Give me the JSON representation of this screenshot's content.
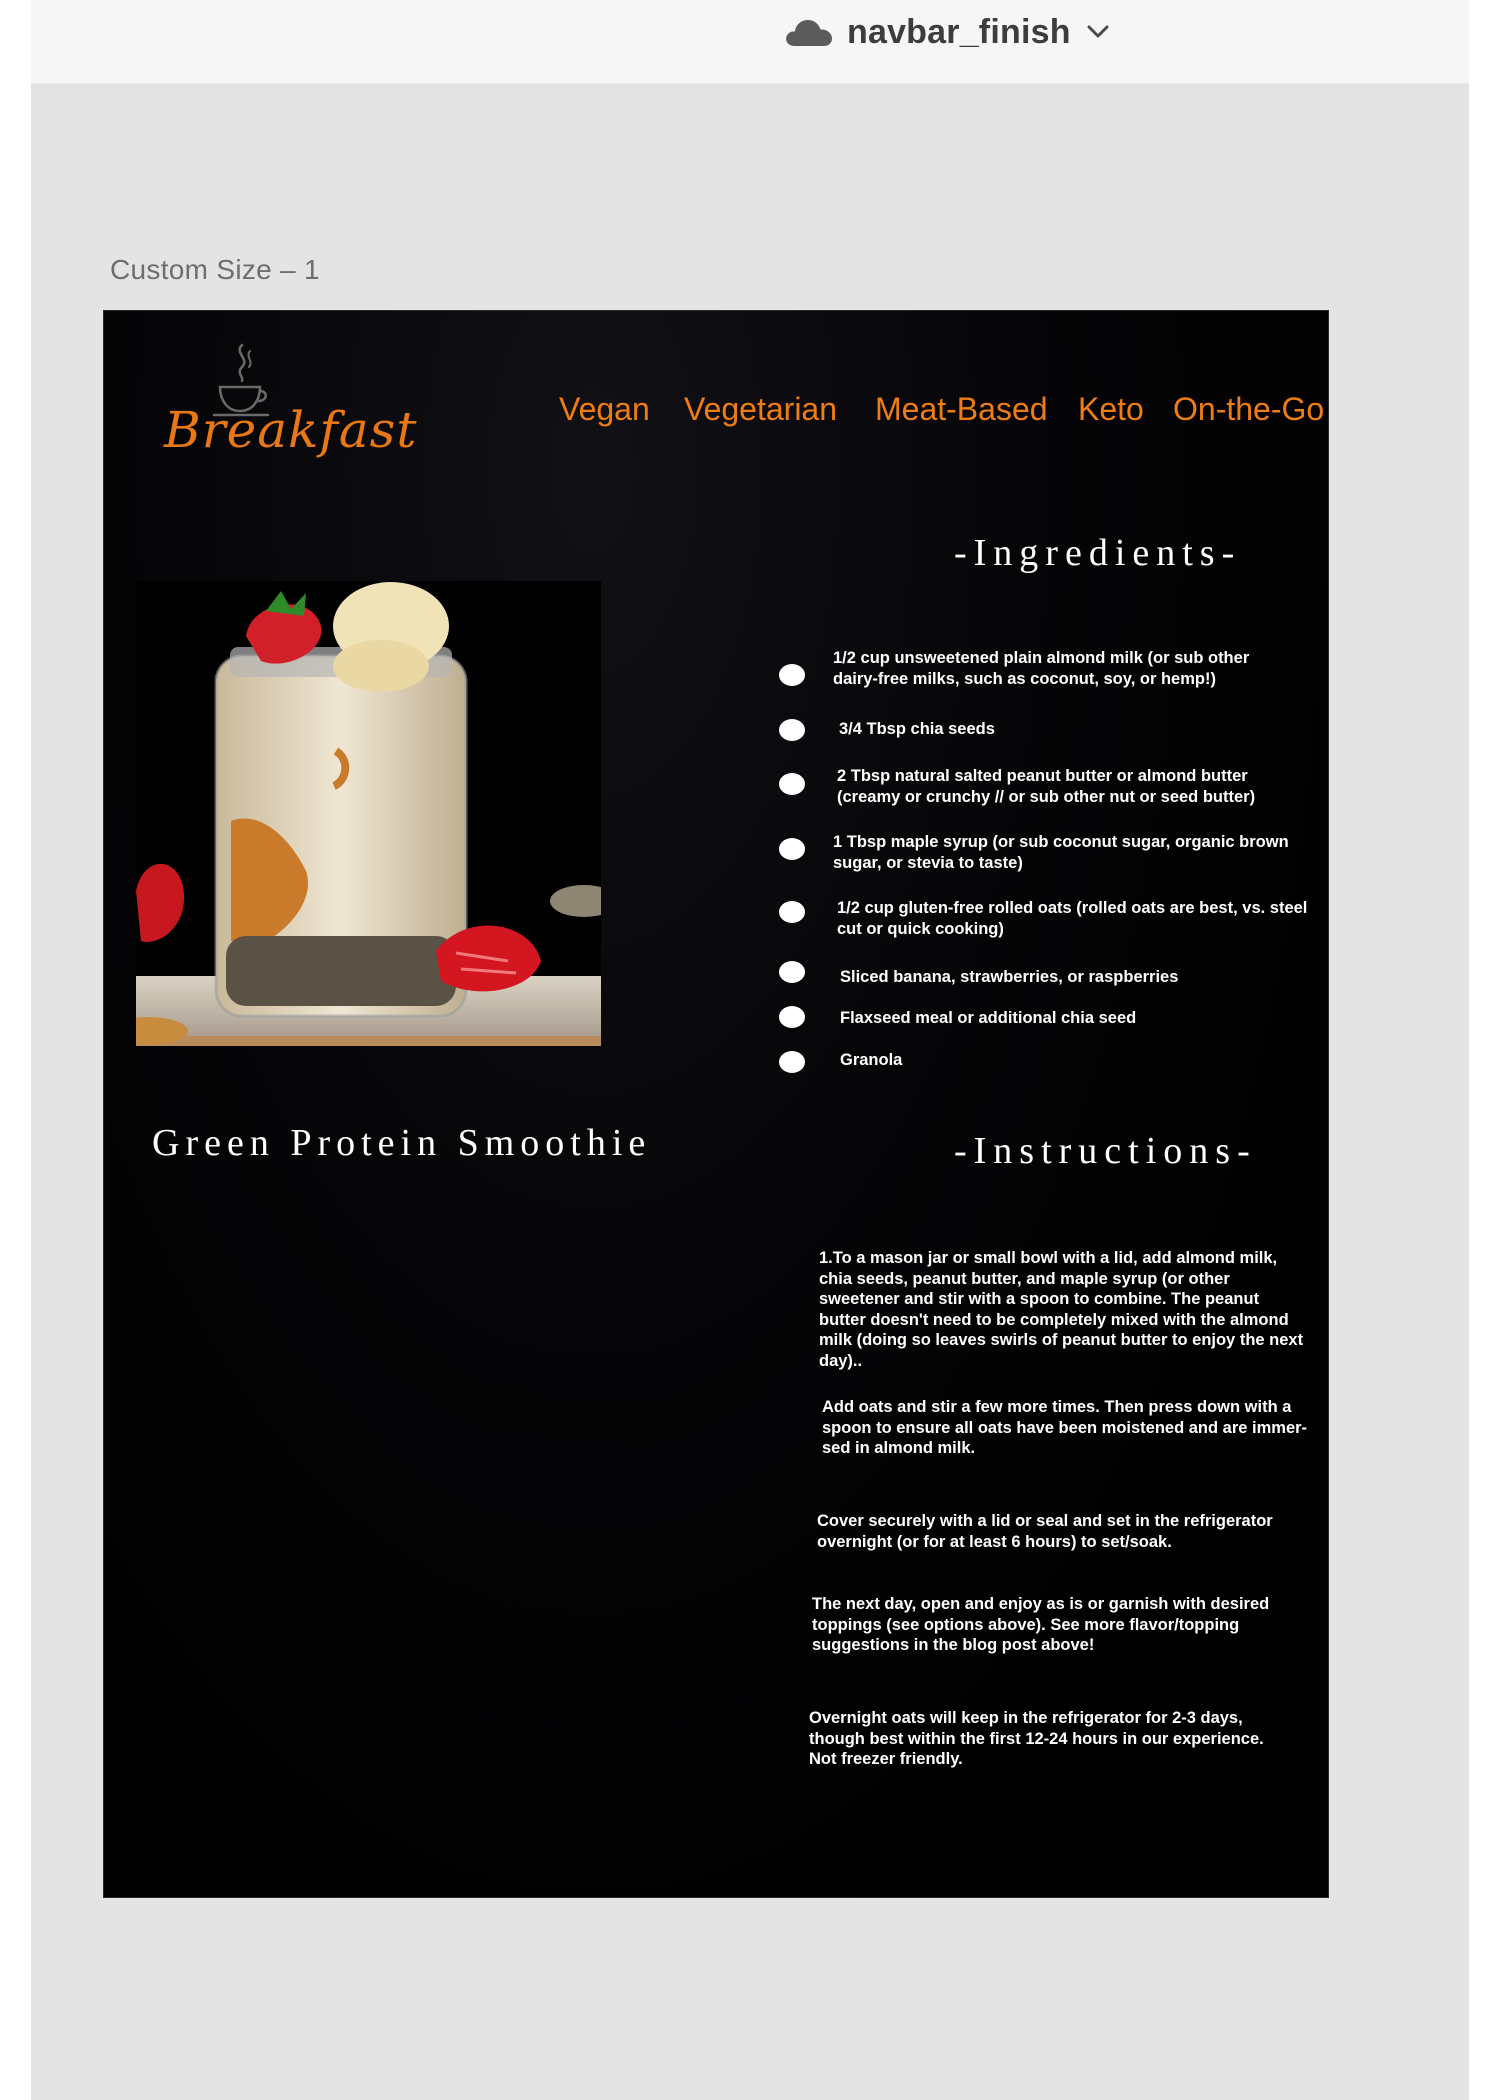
{
  "app": {
    "document_title": "navbar_finish",
    "cloud_icon": "cloud-icon",
    "dropdown_icon": "chevron-down-icon",
    "artboard_label": "Custom Size – 1"
  },
  "site": {
    "logo_text": "Breakfast",
    "logo_icon": "steaming-cup-icon",
    "accent_color": "#ef7d13",
    "nav": [
      "Vegan",
      "Vegetarian",
      "Meat-Based",
      "Keto",
      "On-the-Go"
    ],
    "recipe_title": "Green Protein Smoothie",
    "photo_alt": "overnight-oats-jar-image",
    "ingredients_heading": "-Ingredients-",
    "ingredients": [
      "1/2 cup unsweetened plain almond milk (or sub other\ndairy-free milks, such as coconut, soy, or hemp!)",
      "3/4 Tbsp chia seeds",
      "2 Tbsp natural salted peanut butter or almond butter\n(creamy or crunchy // or sub other nut or seed butter)",
      "1 Tbsp maple syrup (or sub coconut sugar, organic brown\n sugar, or stevia to taste)",
      "1/2 cup gluten-free rolled oats (rolled oats are best, vs. steel\ncut or quick cooking)",
      "Sliced banana, strawberries, or raspberries",
      "Flaxseed meal or additional chia seed",
      "Granola"
    ],
    "instructions_heading": "-Instructions-",
    "instructions": [
      "1.To a mason jar or small bowl with a lid, add almond milk,\n chia seeds, peanut butter, and maple syrup (or other\n sweetener and stir with a spoon to combine. The peanut\n butter doesn't need to be completely mixed with the almond\n milk (doing so leaves swirls of peanut butter to enjoy the next\n day)..",
      "Add oats and stir a few more times. Then press down with a\nspoon to ensure all oats have been moistened and are immer-\nsed in almond milk.",
      "Cover securely with a lid or seal and set in the refrigerator\novernight (or for at least 6 hours) to set/soak.",
      "The next day, open and enjoy as is or garnish with desired\ntoppings (see options above). See more flavor/topping\nsuggestions in the blog post above!",
      "Overnight oats will keep in the refrigerator for 2-3 days,\nthough best within the first 12-24 hours in our experience.\nNot freezer friendly."
    ]
  }
}
